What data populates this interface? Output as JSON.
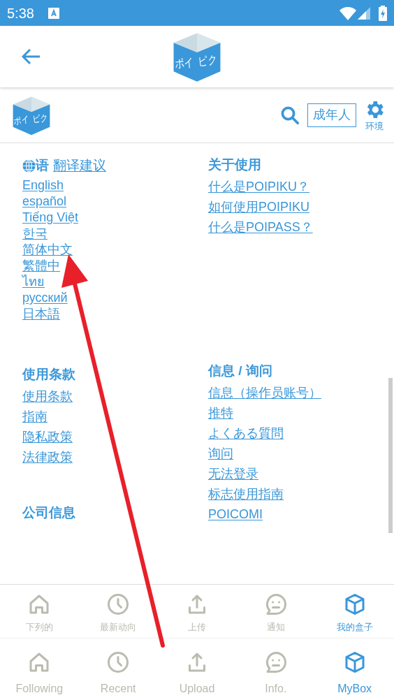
{
  "status_bar": {
    "time": "5:38"
  },
  "header": {
    "logo_text": [
      "ポイ",
      "ピク"
    ]
  },
  "toolbar": {
    "logo_text": [
      "ポイ",
      "ピク"
    ],
    "rating_button": "成年人",
    "settings_label": "环境"
  },
  "columns": [
    {
      "sections": [
        {
          "kind": "language",
          "title": "语",
          "link": "翻译建议",
          "items": [
            "English",
            "español",
            "Tiếng Việt",
            "한국",
            "简体中文",
            "繁體中",
            "ไทย",
            "русский",
            "日本語"
          ]
        },
        {
          "kind": "links",
          "title": "使用条款",
          "items": [
            "使用条款",
            "指南",
            "隐私政策",
            "法律政策"
          ]
        },
        {
          "kind": "links",
          "title": "公司信息"
        }
      ]
    },
    {
      "sections": [
        {
          "kind": "links",
          "title": "关于使用",
          "items": [
            "什么是POIPIKU？",
            "如何使用POIPIKU",
            "什么是POIPASS？"
          ]
        },
        {
          "kind": "links",
          "title": "信息 / 询问",
          "items": [
            "信息（操作员账号）",
            "推特",
            "よくある質問",
            "询问",
            "无法登录",
            "标志使用指南",
            "POICOMI"
          ]
        }
      ]
    }
  ],
  "nav_bars": [
    {
      "items": [
        {
          "label": "下列的",
          "selected": false
        },
        {
          "label": "最新动向",
          "selected": false
        },
        {
          "label": "上传",
          "selected": false
        },
        {
          "label": "通知",
          "selected": false
        },
        {
          "label": "我的盒子",
          "selected": true
        }
      ]
    },
    {
      "items": [
        {
          "label": "Following",
          "selected": false
        },
        {
          "label": "Recent",
          "selected": false
        },
        {
          "label": "Upload",
          "selected": false
        },
        {
          "label": "Info.",
          "selected": false
        },
        {
          "label": "MyBox",
          "selected": true
        }
      ]
    }
  ]
}
